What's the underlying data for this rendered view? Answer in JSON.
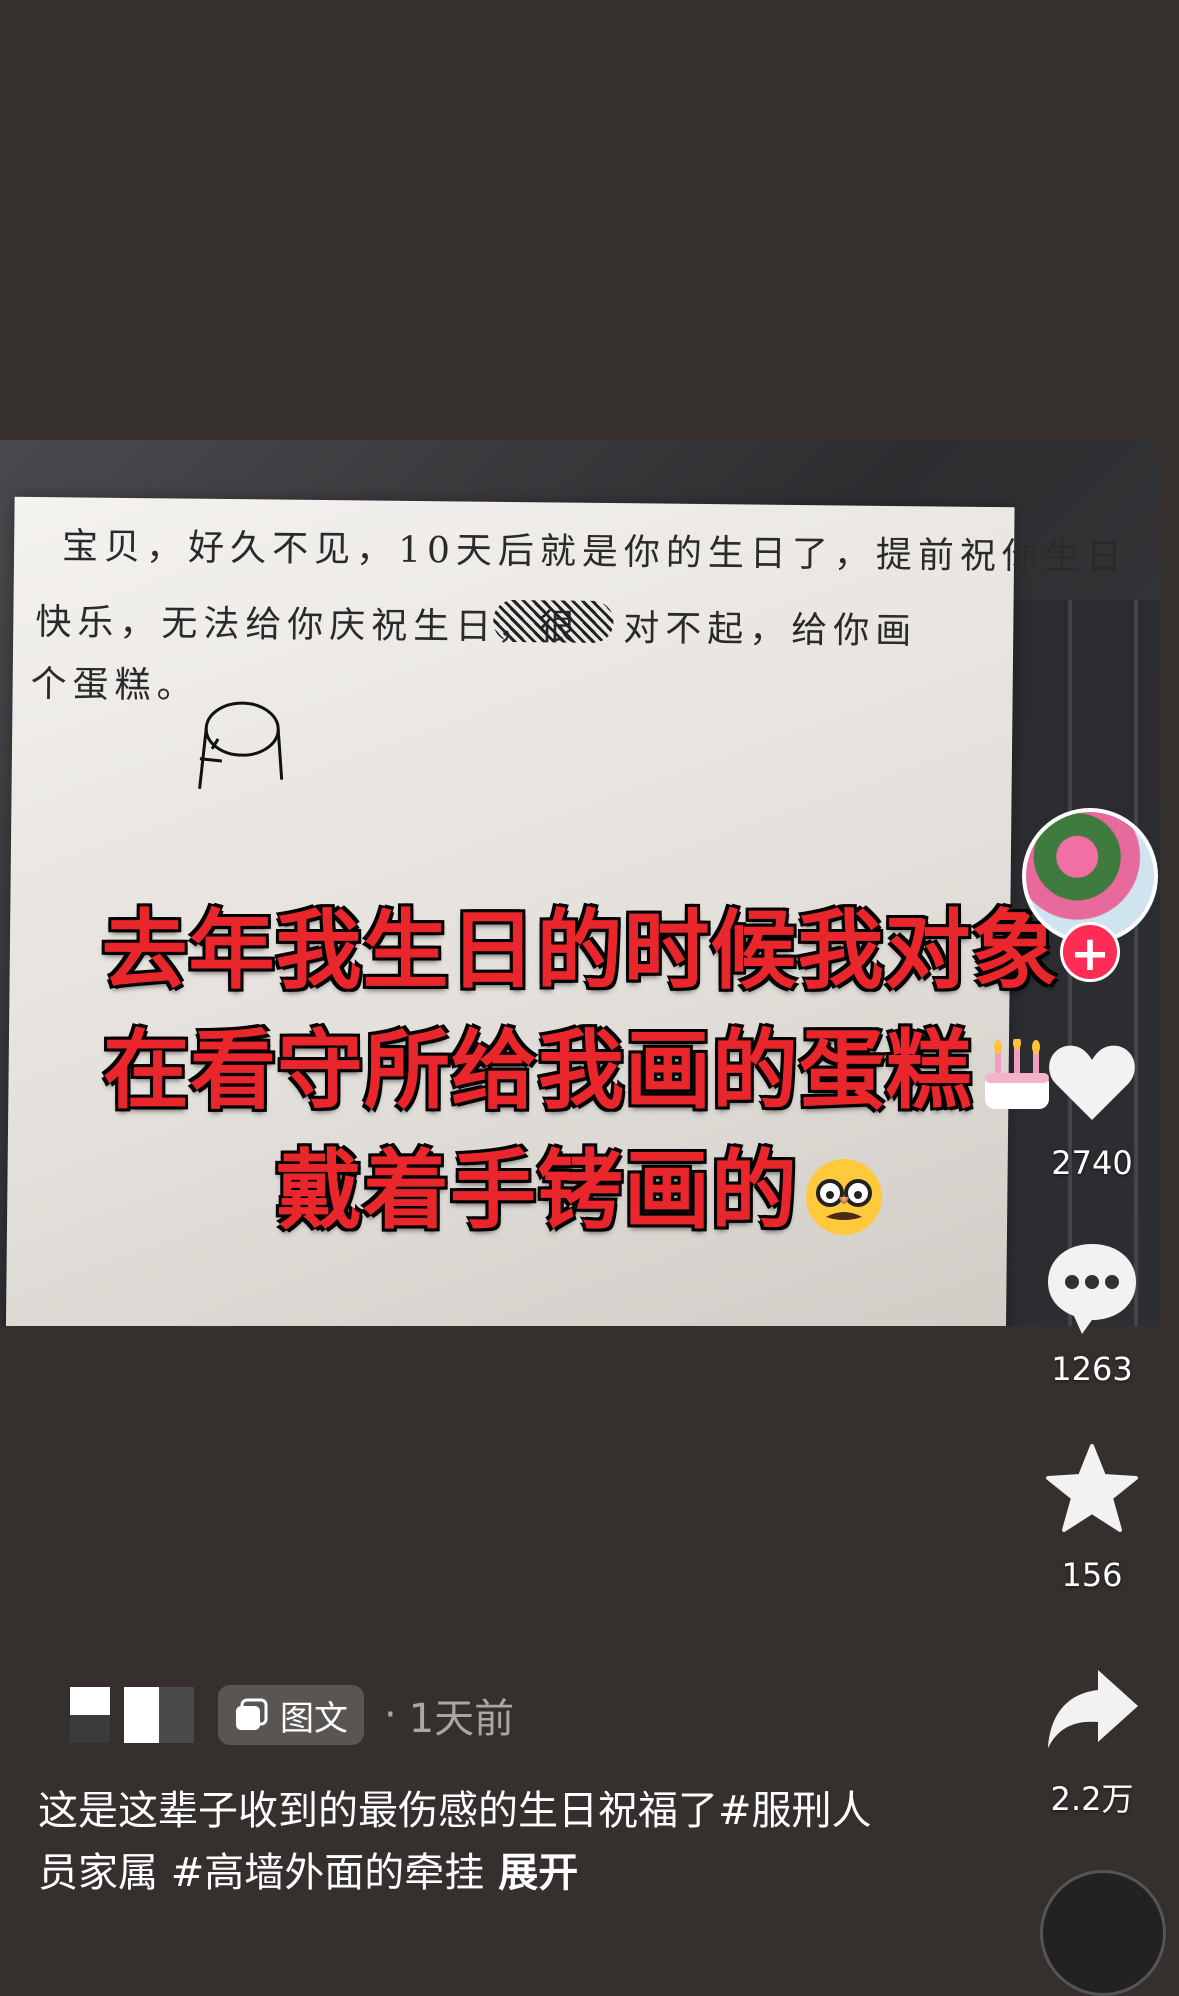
{
  "post": {
    "note_lines": [
      "宝贝，好久不见，10天后就是你的生日了，提前祝你生日",
      "快乐，无法给你庆祝生日，很",
      "对不起，给你画",
      "个蛋糕。"
    ],
    "overlay_lines": [
      "去年我生日的时候我对象",
      "在看守所给我画的蛋糕",
      "戴着手铐画的"
    ]
  },
  "rail": {
    "follow_symbol": "+",
    "likes": "2740",
    "comments": "1263",
    "favorites": "156",
    "shares": "2.2万"
  },
  "meta": {
    "type_tag": "图文",
    "separator": "·",
    "time": "1天前"
  },
  "caption": {
    "text": "这是这辈子收到的最伤感的生日祝福了#服刑人员家属 #高墙外面的牵挂",
    "expand": "展开"
  },
  "colors": {
    "background": "#35302e",
    "overlay_text": "#e8262b",
    "follow_button": "#ff2c55"
  }
}
